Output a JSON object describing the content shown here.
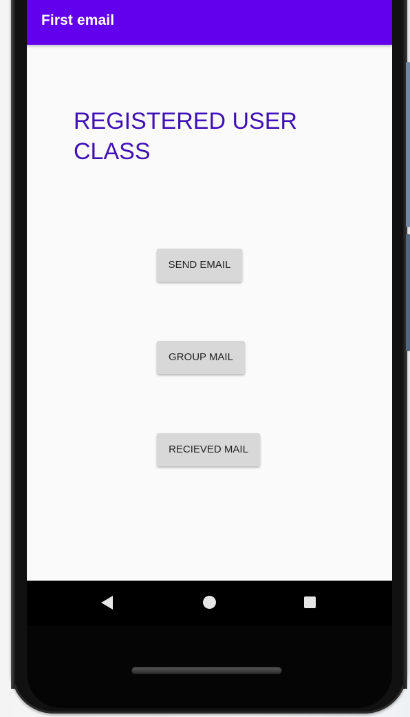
{
  "app_bar": {
    "title": "First email",
    "color": "#6200ee"
  },
  "main": {
    "heading": "REGISTERED USER CLASS",
    "heading_color": "#3f10b5",
    "buttons": [
      {
        "label": "SEND EMAIL"
      },
      {
        "label": "GROUP MAIL"
      },
      {
        "label": "RECIEVED MAIL"
      }
    ]
  },
  "nav_bar": {
    "icons": [
      "back-icon",
      "home-icon",
      "recent-apps-icon"
    ]
  }
}
